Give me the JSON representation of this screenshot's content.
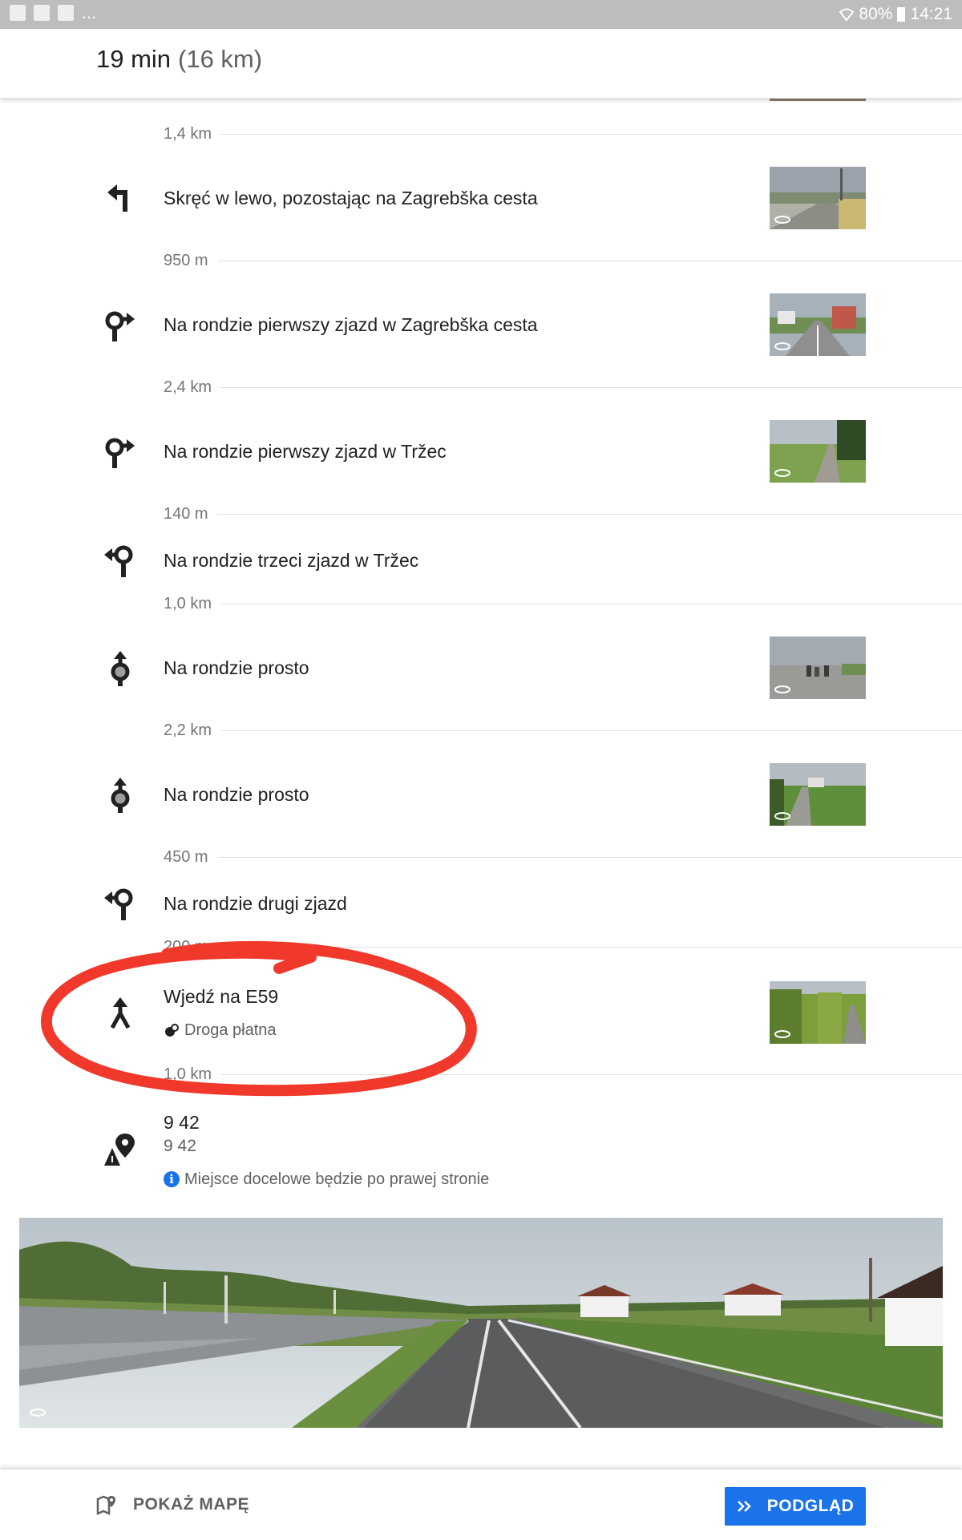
{
  "status_bar": {
    "more": "...",
    "battery": "80%",
    "time": "14:21"
  },
  "header": {
    "time": "19 min",
    "distance": "(16 km)"
  },
  "steps": [
    {
      "distance_before": "1,4 km",
      "instruction": "Skręć w lewo, pozostając na Zagrebška cesta",
      "icon": "turn-left-icon"
    },
    {
      "distance_before": "950 m",
      "instruction": "Na rondzie pierwszy zjazd w Zagrebška cesta",
      "icon": "roundabout-right-icon"
    },
    {
      "distance_before": "2,4 km",
      "instruction": "Na rondzie pierwszy zjazd w Tržec",
      "icon": "roundabout-right-icon"
    },
    {
      "distance_before": "140 m",
      "instruction": "Na rondzie trzeci zjazd w Tržec",
      "icon": "roundabout-left-icon"
    },
    {
      "distance_before": "1,0 km",
      "instruction": "Na rondzie prosto",
      "icon": "roundabout-straight-icon"
    },
    {
      "distance_before": "2,2 km",
      "instruction": "Na rondzie prosto",
      "icon": "roundabout-straight-icon"
    },
    {
      "distance_before": "450 m",
      "instruction": "Na rondzie drugi zjazd",
      "icon": "roundabout-left-icon"
    },
    {
      "distance_before": "200 m",
      "instruction": "Wjedź na E59",
      "note": "Droga płatna",
      "icon": "merge-icon"
    }
  ],
  "last_distance": "1,0 km",
  "destination": {
    "title": "9 42",
    "subtitle": "9 42",
    "info": "Miejsce docelowe będzie po prawej stronie",
    "icon": "destination-icon"
  },
  "bottom_bar": {
    "show_map_label": "POKAŻ MAPĘ",
    "preview_label": "PODGLĄD"
  },
  "colors": {
    "accent": "#1a73e8",
    "annotation": "#f0392b",
    "text_primary": "#212121",
    "text_secondary": "#757575"
  }
}
